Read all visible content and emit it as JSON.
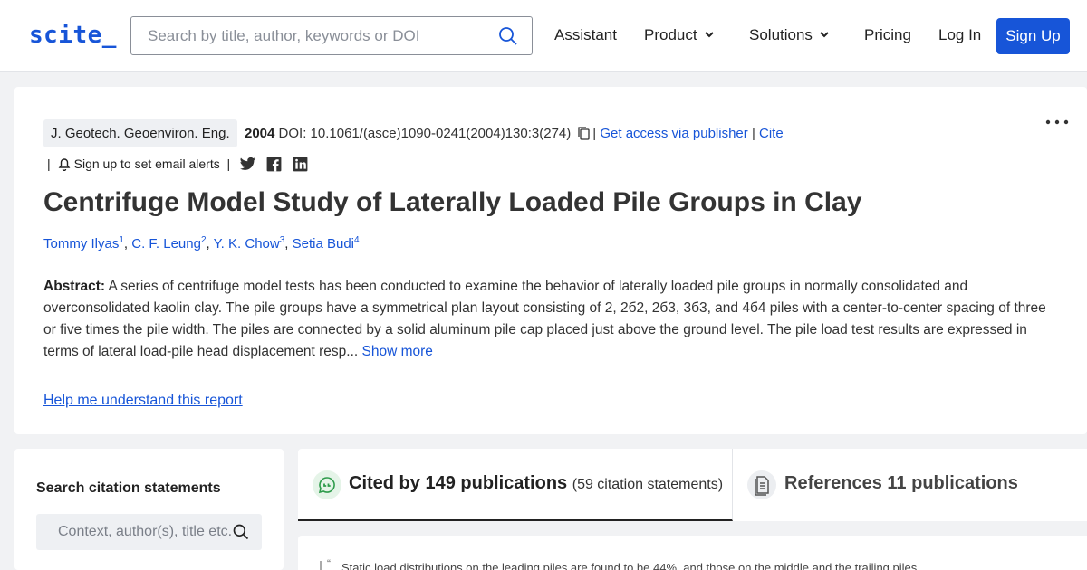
{
  "header": {
    "logo": "scite_",
    "search_placeholder": "Search by title, author, keywords or DOI",
    "nav": {
      "assistant": "Assistant",
      "product": "Product",
      "solutions": "Solutions",
      "pricing": "Pricing",
      "login": "Log In",
      "signup": "Sign Up"
    },
    "brand_color": "#1755d8"
  },
  "paper": {
    "journal": "J. Geotech. Geoenviron. Eng.",
    "year": "2004",
    "doi": "DOI: 10.1061/(asce)1090-0241(2004)130:3(274)",
    "sep": "|",
    "access": "Get access via publisher",
    "cite": "Cite",
    "alerts": "Sign up to set email alerts",
    "title": "Centrifuge Model Study of Laterally Loaded Pile Groups in Clay",
    "authors": [
      {
        "name": "Tommy Ilyas",
        "sup": "1"
      },
      {
        "name": "C. F. Leung",
        "sup": "2"
      },
      {
        "name": "Y. K. Chow",
        "sup": "3"
      },
      {
        "name": "Setia Budi",
        "sup": "4"
      }
    ],
    "abstract_label": "Abstract:",
    "abstract": "A series of centrifuge model tests has been conducted to examine the behavior of laterally loaded pile groups in normally consolidated and overconsolidated kaolin clay. The pile groups have a symmetrical plan layout consisting of 2, 2б2, 2б3, 3б3, and 4б4 piles with a center-to-center spacing of three or five times the pile width. The piles are connected by a solid aluminum pile cap placed just above the ground level. The pile load test results are expressed in terms of lateral load-pile head displacement resp...",
    "show_more": "Show more",
    "help": "Help me understand this report",
    "more_icon": "more-horizontal-icon"
  },
  "citations": {
    "search_title": "Search citation statements",
    "search_placeholder": "Context, author(s), title etc.",
    "tab_cited": "Cited by 149 publications",
    "tab_cited_sub": "(59 citation statements)",
    "tab_references": "References 11 publications",
    "statement_text": "Static load distributions on the leading piles are found to be 44%, and those on the middle and the trailing piles",
    "quote_mark": "“"
  }
}
